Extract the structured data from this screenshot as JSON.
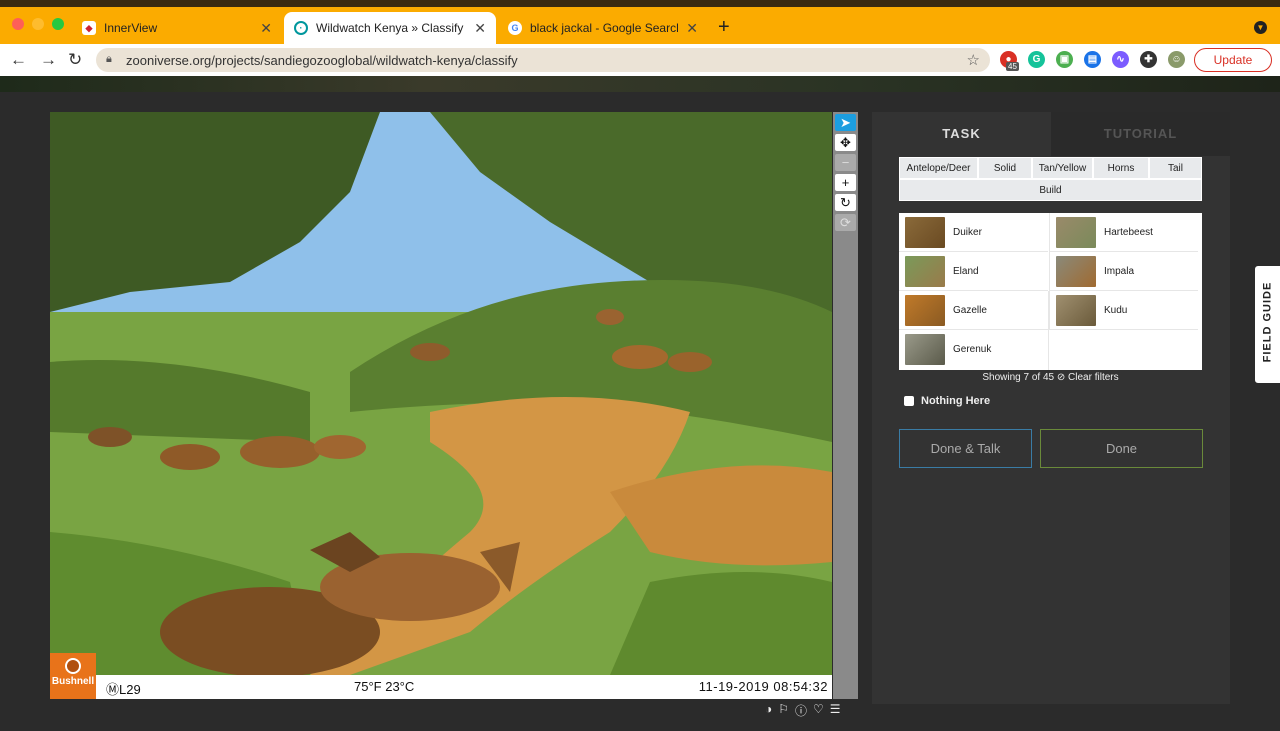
{
  "browser": {
    "tabs": [
      {
        "title": "InnerView",
        "active": false
      },
      {
        "title": "Wildwatch Kenya » Classify —",
        "active": true
      },
      {
        "title": "black jackal - Google Search",
        "active": false
      }
    ],
    "url": "zooniverse.org/projects/sandiegozooglobal/wildwatch-kenya/classify",
    "extension_badge": "45",
    "update_label": "Update",
    "new_tab": "+"
  },
  "subject": {
    "brand": "Bushnell",
    "camera_id": "ⓂL29",
    "temperature": "75°F 23°C",
    "timestamp": "11-19-2019 08:54:32"
  },
  "toolbar": {
    "tools": [
      "pointer-icon",
      "move-icon",
      "zoom-out-icon",
      "zoom-in-icon",
      "rotate-icon",
      "reset-icon"
    ]
  },
  "panel": {
    "tab_task": "TASK",
    "tab_tutorial": "TUTORIAL",
    "filters": {
      "row1": [
        "Antelope/Deer",
        "Solid",
        "Tan/Yellow",
        "Horns",
        "Tail"
      ],
      "row2": "Build"
    },
    "species": [
      {
        "name": "Duiker"
      },
      {
        "name": "Hartebeest"
      },
      {
        "name": "Eland"
      },
      {
        "name": "Impala"
      },
      {
        "name": "Gazelle"
      },
      {
        "name": "Kudu"
      },
      {
        "name": "Gerenuk"
      }
    ],
    "showing": "Showing 7 of 45",
    "clear_filters": "Clear filters",
    "nothing_here": "Nothing Here",
    "done_talk": "Done & Talk",
    "done": "Done"
  },
  "field_guide": "FIELD GUIDE",
  "colors": {
    "chrome": "#fbab00",
    "accent_blue": "#1c9ee0",
    "bushnell_orange": "#e8731a",
    "done_talk_border": "#3a7ca5",
    "done_border": "#6a8a3a"
  }
}
